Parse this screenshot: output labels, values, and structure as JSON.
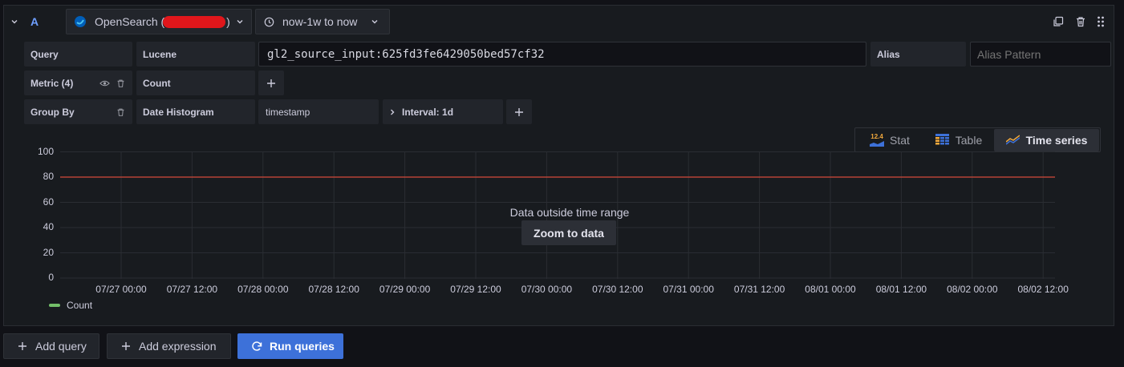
{
  "query_row": {
    "ref_id": "A",
    "datasource_name": "OpenSearch (",
    "datasource_suffix": ")",
    "time_range": "now-1w to now"
  },
  "editor": {
    "query_label": "Query",
    "query_type": "Lucene",
    "query_value": "gl2_source_input:625fd3fe6429050bed57cf32",
    "alias_label": "Alias",
    "alias_placeholder": "Alias Pattern",
    "metric_label": "Metric (4)",
    "metric_type": "Count",
    "group_by_label": "Group By",
    "group_by_type": "Date Histogram",
    "group_by_field": "timestamp",
    "interval_label": "Interval: 1d"
  },
  "viz_tabs": {
    "stat_label": "Stat",
    "stat_icon_text": "12.4",
    "table_label": "Table",
    "timeseries_label": "Time series",
    "active": "Time series"
  },
  "overlay": {
    "message": "Data outside time range",
    "zoom_button": "Zoom to data"
  },
  "chart_data": {
    "type": "line",
    "y_ticks": [
      "100",
      "80",
      "60",
      "40",
      "20",
      "0"
    ],
    "x_ticks": [
      "07/27 00:00",
      "07/27 12:00",
      "07/28 00:00",
      "07/28 12:00",
      "07/29 00:00",
      "07/29 12:00",
      "07/30 00:00",
      "07/30 12:00",
      "07/31 00:00",
      "07/31 12:00",
      "08/01 00:00",
      "08/01 12:00",
      "08/02 00:00",
      "08/02 12:00"
    ],
    "ylim": [
      0,
      100
    ],
    "threshold": 80,
    "threshold_color": "#d44a3a",
    "series": [
      {
        "name": "Count",
        "color": "#73bf69",
        "values": []
      }
    ],
    "legend_position": "bottom-left",
    "grid": true
  },
  "actions": {
    "add_query": "Add query",
    "add_expression": "Add expression",
    "run_queries": "Run queries"
  },
  "colors": {
    "accent": "#3d71d9",
    "redaction": "#e0161b"
  }
}
